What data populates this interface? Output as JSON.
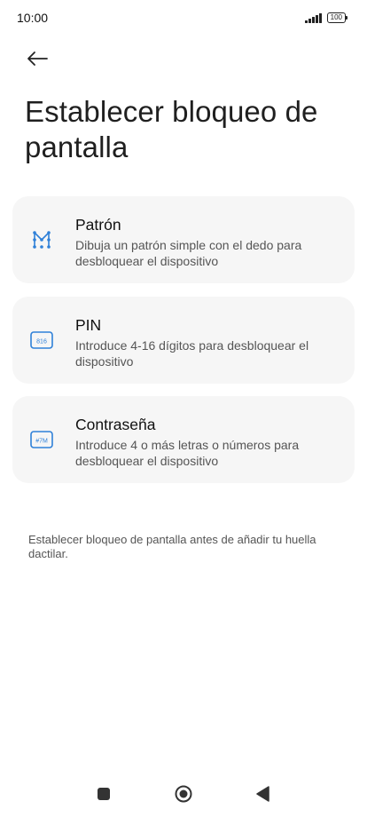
{
  "status_bar": {
    "time": "10:00",
    "battery": "100"
  },
  "header": {
    "back_icon": "arrow-left-icon",
    "title": "Establecer bloqueo de pantalla"
  },
  "options": [
    {
      "icon": "pattern-icon",
      "title": "Patrón",
      "description": "Dibuja un patrón simple con el dedo para desbloquear el dispositivo"
    },
    {
      "icon": "pin-icon",
      "icon_text": "816",
      "title": "PIN",
      "description": "Introduce 4-16 dígitos para desbloquear el dispositivo"
    },
    {
      "icon": "password-icon",
      "icon_text": "#7M",
      "title": "Contraseña",
      "description": "Introduce 4 o más letras o números para desbloquear el dispositivo"
    }
  ],
  "footer_note": "Establecer bloqueo de pantalla antes de añadir tu huella dactilar.",
  "colors": {
    "accent": "#2f80d8",
    "card_bg": "#f6f6f6"
  },
  "nav": {
    "recents_icon": "square-icon",
    "home_icon": "circle-home-icon",
    "back_icon": "triangle-back-icon"
  }
}
